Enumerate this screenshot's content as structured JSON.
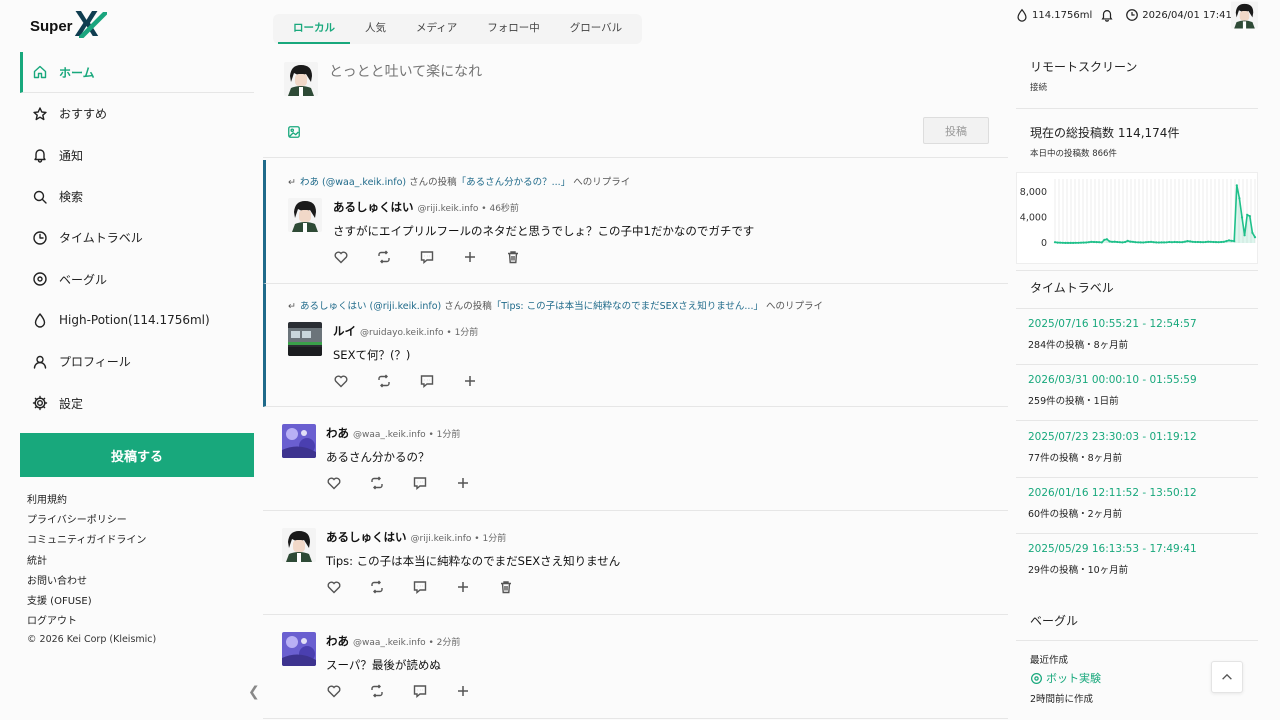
{
  "brand": {
    "name": "Super",
    "mark": "X"
  },
  "nav": [
    {
      "label": "ホーム",
      "icon": "home-icon",
      "active": true
    },
    {
      "label": "おすすめ",
      "icon": "star-icon"
    },
    {
      "label": "通知",
      "icon": "bell-icon"
    },
    {
      "label": "検索",
      "icon": "search-icon"
    },
    {
      "label": "タイムトラベル",
      "icon": "clock-icon"
    },
    {
      "label": "ベーグル",
      "icon": "bagel-icon"
    },
    {
      "label": "High-Potion(114.1756ml)",
      "icon": "drop-icon"
    },
    {
      "label": "プロフィール",
      "icon": "user-icon"
    },
    {
      "label": "設定",
      "icon": "gear-icon"
    }
  ],
  "post_button": "投稿する",
  "footer": [
    "利用規約",
    "プライバシーポリシー",
    "コミュニティガイドライン",
    "統計",
    "お問い合わせ",
    "支援 (OFUSE)",
    "ログアウト"
  ],
  "copyright": "© 2026 Kei Corp (Kleismic)",
  "tabs": [
    "ローカル",
    "人気",
    "メディア",
    "フォロー中",
    "グローバル"
  ],
  "composer": {
    "placeholder": "とっとと吐いて楽になれ",
    "submit": "投稿"
  },
  "posts": [
    {
      "reply": true,
      "reply_user": "わあ (@waa_.keik.info)",
      "reply_mid": " さんの投稿",
      "reply_quote": "「あるさん分かるの？...」",
      "reply_tail": " へのリプライ",
      "name": "あるしゅくはい",
      "meta": "@riji.keik.info • 46秒前",
      "text": "さすがにエイプリルフールのネタだと思うでしょ？この子中1だかなのでガチです",
      "delete": true,
      "avatar": "boy"
    },
    {
      "reply": true,
      "reply_user": "あるしゅくはい (@riji.keik.info)",
      "reply_mid": " さんの投稿",
      "reply_quote": "「Tips: この子は本当に純粋なのでまだSEXさえ知りません...」",
      "reply_tail": " へのリプライ",
      "name": "ルイ",
      "meta": "@ruidayo.keik.info • 1分前",
      "text": "SEXて何？(？)",
      "delete": false,
      "avatar": "train"
    },
    {
      "reply": false,
      "name": "わあ",
      "meta": "@waa_.keik.info • 1分前",
      "text": "あるさん分かるの？",
      "delete": false,
      "avatar": "purple"
    },
    {
      "reply": false,
      "name": "あるしゅくはい",
      "meta": "@riji.keik.info • 1分前",
      "text": "Tips: この子は本当に純粋なのでまだSEXさえ知りません",
      "delete": true,
      "avatar": "boy"
    },
    {
      "reply": false,
      "name": "わあ",
      "meta": "@waa_.keik.info • 2分前",
      "text": "スーパ？最後が読めぬ",
      "delete": false,
      "avatar": "purple"
    }
  ],
  "topbar": {
    "potion": "114.1756ml",
    "datetime": "2026/04/01 17:41:18"
  },
  "remote": {
    "title": "リモートスクリーン",
    "status": "接続"
  },
  "stats": {
    "title": "現在の総投稿数 114,174件",
    "today": "本日中の投稿数 866件"
  },
  "chart_data": {
    "type": "area",
    "yticks": [
      "8,000",
      "4,000",
      "0"
    ],
    "ylim": [
      0,
      10000
    ],
    "values": [
      120,
      60,
      40,
      30,
      20,
      10,
      15,
      20,
      30,
      25,
      40,
      60,
      80,
      120,
      180,
      160,
      140,
      120,
      100,
      500,
      600,
      250,
      180,
      200,
      150,
      120,
      100,
      150,
      350,
      220,
      180,
      130,
      110,
      100,
      80,
      120,
      150,
      180,
      120,
      100,
      80,
      100,
      90,
      110,
      150,
      130,
      160,
      140,
      130,
      120,
      200,
      300,
      250,
      180,
      150,
      160,
      140,
      130,
      150,
      200,
      180,
      160,
      140,
      120,
      150,
      180,
      300,
      400,
      350,
      300,
      9000,
      7000,
      4000,
      1200,
      4400,
      4200,
      1600,
      900
    ],
    "color": "#1fc08a"
  },
  "timetravel": {
    "title": "タイムトラベル",
    "items": [
      {
        "range": "2025/07/16 10:55:21 - 12:54:57",
        "info": "284件の投稿・8ヶ月前"
      },
      {
        "range": "2026/03/31 00:00:10 - 01:55:59",
        "info": "259件の投稿・1日前"
      },
      {
        "range": "2025/07/23 23:30:03 - 01:19:12",
        "info": "77件の投稿・8ヶ月前"
      },
      {
        "range": "2026/01/16 12:11:52 - 13:50:12",
        "info": "60件の投稿・2ヶ月前"
      },
      {
        "range": "2025/05/29 16:13:53 - 17:49:41",
        "info": "29件の投稿・10ヶ月前"
      }
    ]
  },
  "bagel": {
    "title": "ベーグル",
    "recent_label": "最近作成",
    "name": "ボット実験",
    "time": "2時間前に作成"
  },
  "colors": {
    "accent": "#18a87c",
    "reply_bar": "#1f6a8a"
  }
}
